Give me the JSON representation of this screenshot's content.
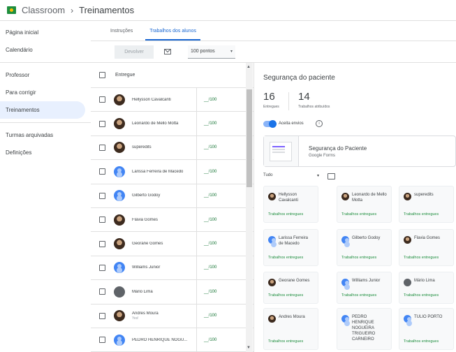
{
  "header": {
    "app": "Classroom",
    "sep": "›",
    "crumb": "Treinamentos"
  },
  "sidebar": {
    "group1": [
      "Página inicial",
      "Calendário"
    ],
    "group2": [
      "Professor",
      "Para corrigir",
      "Treinamentos"
    ],
    "group3": [
      "Turmas arquivadas",
      "Definições"
    ]
  },
  "tabs": [
    "Instruções",
    "Trabalhos dos alunos"
  ],
  "toolbar": {
    "return_label": "Devolver",
    "points": "100 pontos",
    "points_caret": "▾"
  },
  "list": {
    "header": "Entregue",
    "rows": [
      {
        "name": "Hellysson Cavalcanti",
        "sub": "",
        "grade": "__/100",
        "avatar": "photo"
      },
      {
        "name": "Leonardo de Mello Motta",
        "sub": "",
        "grade": "__/100",
        "avatar": "photo"
      },
      {
        "name": "superedits",
        "sub": "",
        "grade": "__/100",
        "avatar": "photo"
      },
      {
        "name": "Larissa Ferreira de Macedo",
        "sub": "",
        "grade": "__/100",
        "avatar": "blue"
      },
      {
        "name": "Gilberto Godoy",
        "sub": "",
        "grade": "__/100",
        "avatar": "blue"
      },
      {
        "name": "Flavia Gomes",
        "sub": "",
        "grade": "__/100",
        "avatar": "photo"
      },
      {
        "name": "Georane Gomes",
        "sub": "",
        "grade": "__/100",
        "avatar": "photo"
      },
      {
        "name": "Williams Junior",
        "sub": "",
        "grade": "__/100",
        "avatar": "blue"
      },
      {
        "name": "Mário Lima",
        "sub": "",
        "grade": "__/100",
        "avatar": "gray"
      },
      {
        "name": "Andres Moura",
        "sub": "Yes!",
        "grade": "__/100",
        "avatar": "photo"
      },
      {
        "name": "PEDRO HENRIQUE NOGU...",
        "sub": "",
        "grade": "__/100",
        "avatar": "blue"
      }
    ]
  },
  "detail": {
    "title": "Segurança do paciente",
    "delivered_count": "16",
    "delivered_label": "Entregues",
    "assigned_count": "14",
    "assigned_label": "Trabalhos atribuídos",
    "accept_label": "Aceita envios",
    "info": "i",
    "attachment_title": "Segurança do Paciente",
    "attachment_sub": "Google Forms",
    "filter": "Tudo",
    "filter_caret": "▾",
    "cards": [
      {
        "name": "Hellysson Cavalcanti",
        "status": "Trabalhos entregues",
        "avatar": "photo"
      },
      {
        "name": "Leonardo de Mello Motta",
        "status": "Trabalhos entregues",
        "avatar": "photo"
      },
      {
        "name": "superedits",
        "status": "Trabalhos entregues",
        "avatar": "photo"
      },
      {
        "name": "Larissa Ferreira de Macedo",
        "status": "Trabalhos entregues",
        "avatar": "blue"
      },
      {
        "name": "Gilberto Godoy",
        "status": "Trabalhos entregues",
        "avatar": "blue"
      },
      {
        "name": "Flavia Gomes",
        "status": "Trabalhos entregues",
        "avatar": "photo"
      },
      {
        "name": "Georane Gomes",
        "status": "Trabalhos entregues",
        "avatar": "photo"
      },
      {
        "name": "Williams Junior",
        "status": "Trabalhos entregues",
        "avatar": "blue"
      },
      {
        "name": "Mário Lima",
        "status": "Trabalhos entregues",
        "avatar": "gray"
      },
      {
        "name": "Andres Moura",
        "status": "Trabalhos entregues",
        "avatar": "photo"
      },
      {
        "name": "PEDRO HENRIQUE NOGUEIRA TRIGUEIRO CARNEIRO",
        "status": "",
        "avatar": "blue"
      },
      {
        "name": "TULIO PORTO",
        "status": "Trabalhos entregues",
        "avatar": "blue"
      }
    ]
  },
  "colors": {
    "accent": "#1967d2",
    "green": "#1e8e3e",
    "brand": "#1e8e3e"
  }
}
